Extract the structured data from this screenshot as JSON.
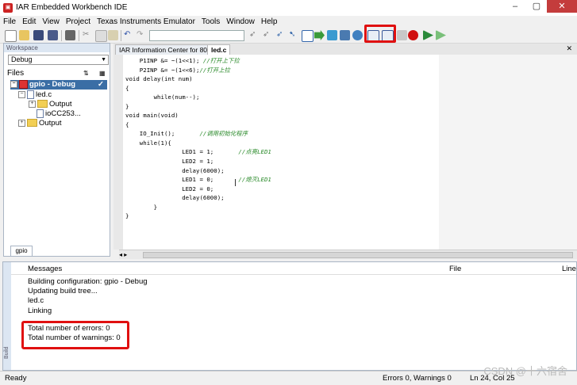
{
  "window": {
    "title": "IAR Embedded Workbench IDE"
  },
  "menu": [
    "File",
    "Edit",
    "View",
    "Project",
    "Texas Instruments Emulator",
    "Tools",
    "Window",
    "Help"
  ],
  "workspace": {
    "header": "Workspace",
    "config": "Debug",
    "files_label": "Files",
    "tree": [
      {
        "label": "gpio - Debug",
        "level": 0,
        "type": "project",
        "check": "✓"
      },
      {
        "label": "led.c",
        "level": 1,
        "type": "file"
      },
      {
        "label": "Output",
        "level": 2,
        "type": "folder"
      },
      {
        "label": "ioCC253...",
        "level": 2,
        "type": "file"
      },
      {
        "label": "Output",
        "level": 1,
        "type": "folder"
      }
    ],
    "tab": "gpio"
  },
  "editor": {
    "tabs": [
      "IAR Information Center for 8051",
      "led.c"
    ],
    "active_tab": "led.c",
    "code": [
      {
        "t": "    P1INP &= ~(1<<1); ",
        "c": "//打开上下拉"
      },
      {
        "t": "    P2INP &= ~(1<<6);",
        "c": "//打开上拉"
      },
      {
        "t": "void delay(int num)",
        "c": ""
      },
      {
        "t": "{",
        "c": ""
      },
      {
        "t": "        while(num--);",
        "c": ""
      },
      {
        "t": "}",
        "c": ""
      },
      {
        "t": "void main(void)",
        "c": ""
      },
      {
        "t": "{",
        "c": ""
      },
      {
        "t": "    IO_Init();       ",
        "c": "//调用初始化程序"
      },
      {
        "t": "    while(1){",
        "c": ""
      },
      {
        "t": "                LED1 = 1;       ",
        "c": "//点亮LED1"
      },
      {
        "t": "                LED2 = 1;",
        "c": ""
      },
      {
        "t": "                delay(6000);",
        "c": ""
      },
      {
        "t": "                LED1 = 0;       ",
        "c": "//熄灭LED1"
      },
      {
        "t": "                LED2 = 0;",
        "c": ""
      },
      {
        "t": "                delay(6000);",
        "c": ""
      },
      {
        "t": "        }",
        "c": ""
      },
      {
        "t": "}",
        "c": ""
      }
    ]
  },
  "messages": {
    "side_label": "Build",
    "headers": {
      "messages": "Messages",
      "file": "File",
      "line": "Line"
    },
    "lines": [
      "Building configuration: gpio - Debug",
      "Updating build tree...",
      "led.c",
      "Linking"
    ],
    "summary": [
      "Total number of errors: 0",
      "Total number of warnings: 0"
    ]
  },
  "status": {
    "left": "Ready",
    "errors": "Errors 0, Warnings 0",
    "position": "Ln 24, Col 25"
  },
  "watermark": "CSDN @十六宿舍",
  "colors": {
    "highlight": "#e01010",
    "comment": "#2a8a2a"
  }
}
